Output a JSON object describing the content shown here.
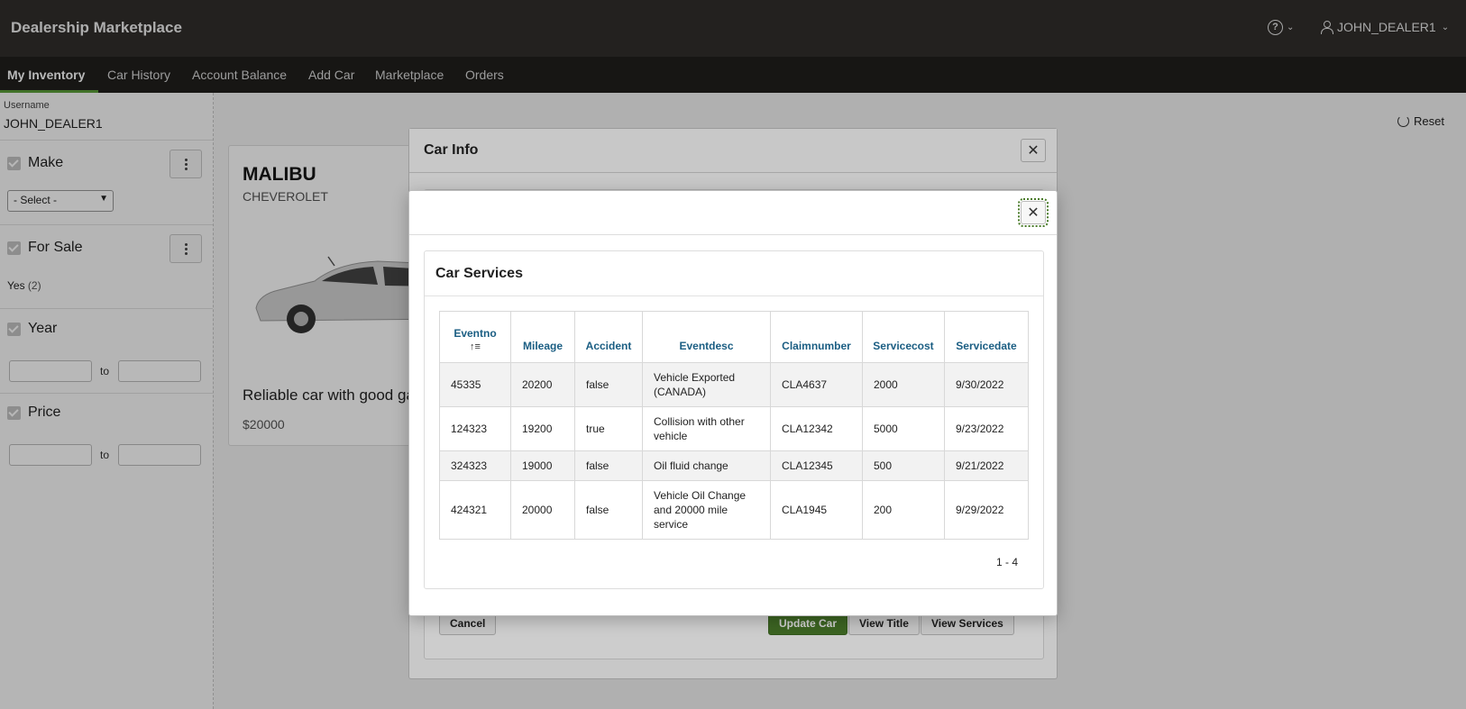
{
  "header": {
    "app_title": "Dealership Marketplace",
    "user_name": "JOHN_DEALER1"
  },
  "nav": {
    "items": [
      "My Inventory",
      "Car History",
      "Account Balance",
      "Add Car",
      "Marketplace",
      "Orders"
    ]
  },
  "sidebar": {
    "username_label": "Username",
    "username_value": "JOHN_DEALER1",
    "facets": {
      "make": {
        "label": "Make",
        "select_value": "- Select -"
      },
      "for_sale": {
        "label": "For Sale",
        "option_label": "Yes",
        "option_count": "(2)"
      },
      "year": {
        "label": "Year",
        "to_label": "to"
      },
      "price": {
        "label": "Price",
        "to_label": "to"
      }
    }
  },
  "main": {
    "reset_label": "Reset",
    "card": {
      "model": "MALIBU",
      "make": "CHEVEROLET",
      "description": "Reliable car with good gas",
      "price": "$20000"
    }
  },
  "car_info_dialog": {
    "title": "Car Info",
    "buttons": {
      "cancel": "Cancel",
      "update": "Update Car",
      "view_title": "View Title",
      "view_services": "View Services"
    }
  },
  "services_dialog": {
    "region_title": "Car Services",
    "columns": [
      "Eventno",
      "Mileage",
      "Accident",
      "Eventdesc",
      "Claimnumber",
      "Servicecost",
      "Servicedate"
    ],
    "rows": [
      [
        "45335",
        "20200",
        "false",
        "Vehicle Exported (CANADA)",
        "CLA4637",
        "2000",
        "9/30/2022"
      ],
      [
        "124323",
        "19200",
        "true",
        "Collision with other vehicle",
        "CLA12342",
        "5000",
        "9/23/2022"
      ],
      [
        "324323",
        "19000",
        "false",
        "Oil fluid change",
        "CLA12345",
        "500",
        "9/21/2022"
      ],
      [
        "424321",
        "20000",
        "false",
        "Vehicle Oil Change and 20000 mile service",
        "CLA1945",
        "200",
        "9/29/2022"
      ]
    ],
    "pagination": "1 - 4"
  },
  "colors": {
    "header_bg": "#312f2c",
    "nav_bg": "#201f1d",
    "nav_active_underline": "#5a9e3a",
    "primary_button": "#4a7b2a",
    "table_header_text": "#1b5e83"
  },
  "icons": {
    "help": "help-circle-icon",
    "user": "user-icon",
    "reset": "reset-icon",
    "close": "close-icon",
    "sort": "sort-ascending-icon",
    "menu": "kebab-menu-icon"
  }
}
